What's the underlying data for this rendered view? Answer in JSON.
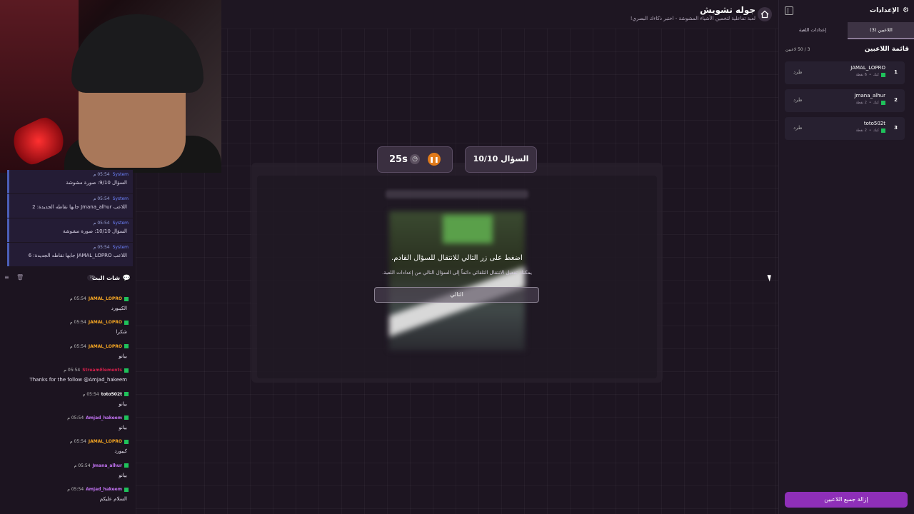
{
  "header": {
    "title": "جوله تشويش",
    "subtitle": "لعبة تفاعلية لتخمين الأشياء المشوشة - اختبر ذكاءك البصري!"
  },
  "timer": {
    "value": "25s"
  },
  "question": {
    "label": "السؤال 10/10"
  },
  "next_prompt": {
    "title": "اضغط على زر التالي للانتقال للسؤال القادم.",
    "subtitle": "يمكنك تفعيل الانتقال التلقائي دائماً إلى السؤال التالي من إعدادات اللعبة.",
    "button_label": "التالي"
  },
  "system_messages": [
    {
      "name": "System",
      "time": "05:54 م",
      "text": "السؤال 9/10: صورة مشوشة"
    },
    {
      "name": "System",
      "time": "05:54 م",
      "text": "اللاعب Jmana_alhur جابها نقاطه الجديدة: 2"
    },
    {
      "name": "System",
      "time": "05:54 م",
      "text": "السؤال 10/10: صورة مشوشة"
    },
    {
      "name": "System",
      "time": "05:54 م",
      "text": "اللاعب JAMAL_LOPRO جابها نقاطه الجديدة: 6"
    }
  ],
  "chat": {
    "title": "شات البث",
    "count": "78",
    "messages": [
      {
        "user": "JAMAL_LOPRO",
        "color": "#f5a623",
        "time": "05:54 م",
        "text": "الكيبورد"
      },
      {
        "user": "JAMAL_LOPRO",
        "color": "#f5a623",
        "time": "05:54 م",
        "text": "شكرا"
      },
      {
        "user": "JAMAL_LOPRO",
        "color": "#f5a623",
        "time": "05:54 م",
        "text": "بيانو"
      },
      {
        "user": "StreamElements",
        "color": "#d21f4a",
        "time": "05:54 م",
        "text": "Thanks for the follow @Amjad_hakeem"
      },
      {
        "user": "toto502t",
        "color": "#ffffff",
        "time": "05:54 م",
        "text": "بيانو"
      },
      {
        "user": "Amjad_hakeem",
        "color": "#c072f0",
        "time": "05:54 م",
        "text": "بيانو"
      },
      {
        "user": "JAMAL_LOPRO",
        "color": "#f5a623",
        "time": "05:54 م",
        "text": "كيبورد"
      },
      {
        "user": "Jmana_alhur",
        "color": "#c072f0",
        "time": "05:54 م",
        "text": "بيانو"
      },
      {
        "user": "Amjad_hakeem",
        "color": "#c072f0",
        "time": "05:54 م",
        "text": "السلام عليكم"
      }
    ]
  },
  "sidebar": {
    "title": "الإعدادات",
    "tabs": [
      "اللاعبين (3)",
      "إعدادات اللعبة"
    ],
    "players_heading": "قائمة اللاعبين",
    "players_count": "3 / 50 لاعبين",
    "players": [
      {
        "rank": "1",
        "name": "JAMAL_LOPRO",
        "platform": "كيك",
        "points": "6 نقطة",
        "kick": "طرد"
      },
      {
        "rank": "2",
        "name": "Jmana_alhur",
        "platform": "كيك",
        "points": "2 نقطة",
        "kick": "طرد"
      },
      {
        "rank": "3",
        "name": "toto502t",
        "platform": "كيك",
        "points": "2 نقطة",
        "kick": "طرد"
      }
    ],
    "remove_all_label": "إزالة جميع اللاعبين"
  },
  "colors": {
    "accent": "#8e2fb8",
    "pause": "#e07a1a",
    "kick_badge": "#1fc25b",
    "system": "#4b5fb8"
  },
  "icons": [
    "home-icon",
    "gear-icon",
    "collapse-sidebar-icon",
    "clock-icon",
    "pause-icon",
    "chat-icon",
    "kick-logo-icon"
  ]
}
